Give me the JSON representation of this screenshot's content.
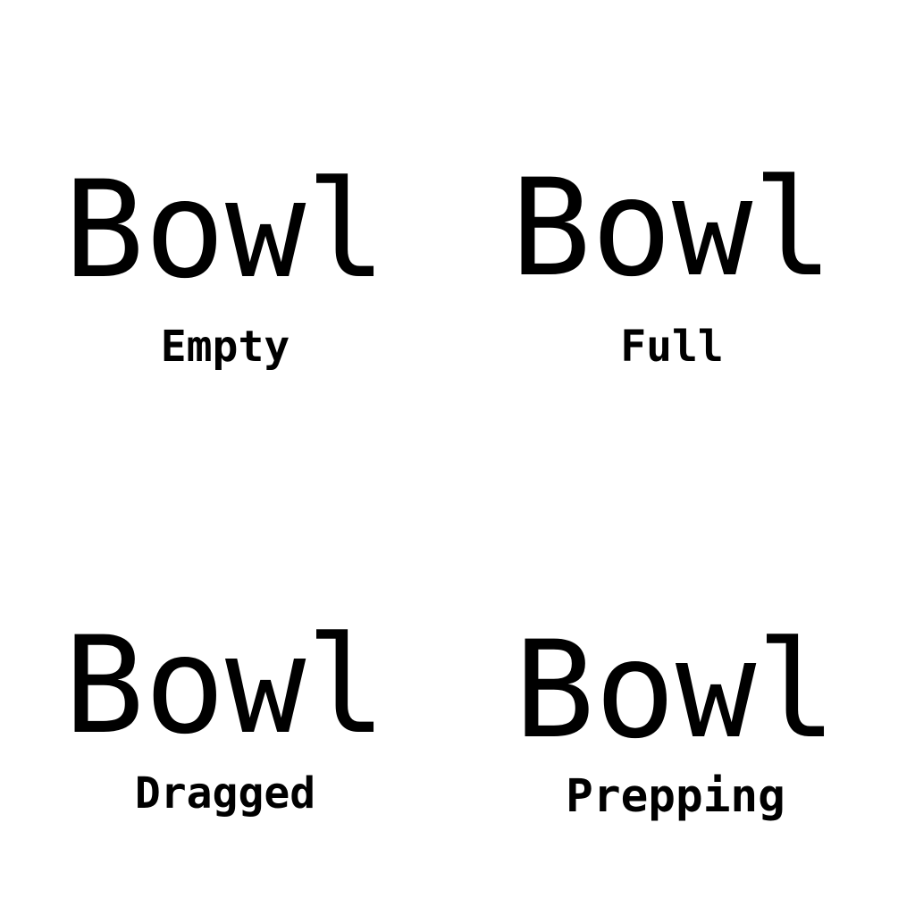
{
  "states": [
    {
      "title": "Bowl",
      "label": "Empty"
    },
    {
      "title": "Bowl",
      "label": "Full"
    },
    {
      "title": "Bowl",
      "label": "Dragged"
    },
    {
      "title": "Bowl",
      "label": "Prepping"
    }
  ]
}
